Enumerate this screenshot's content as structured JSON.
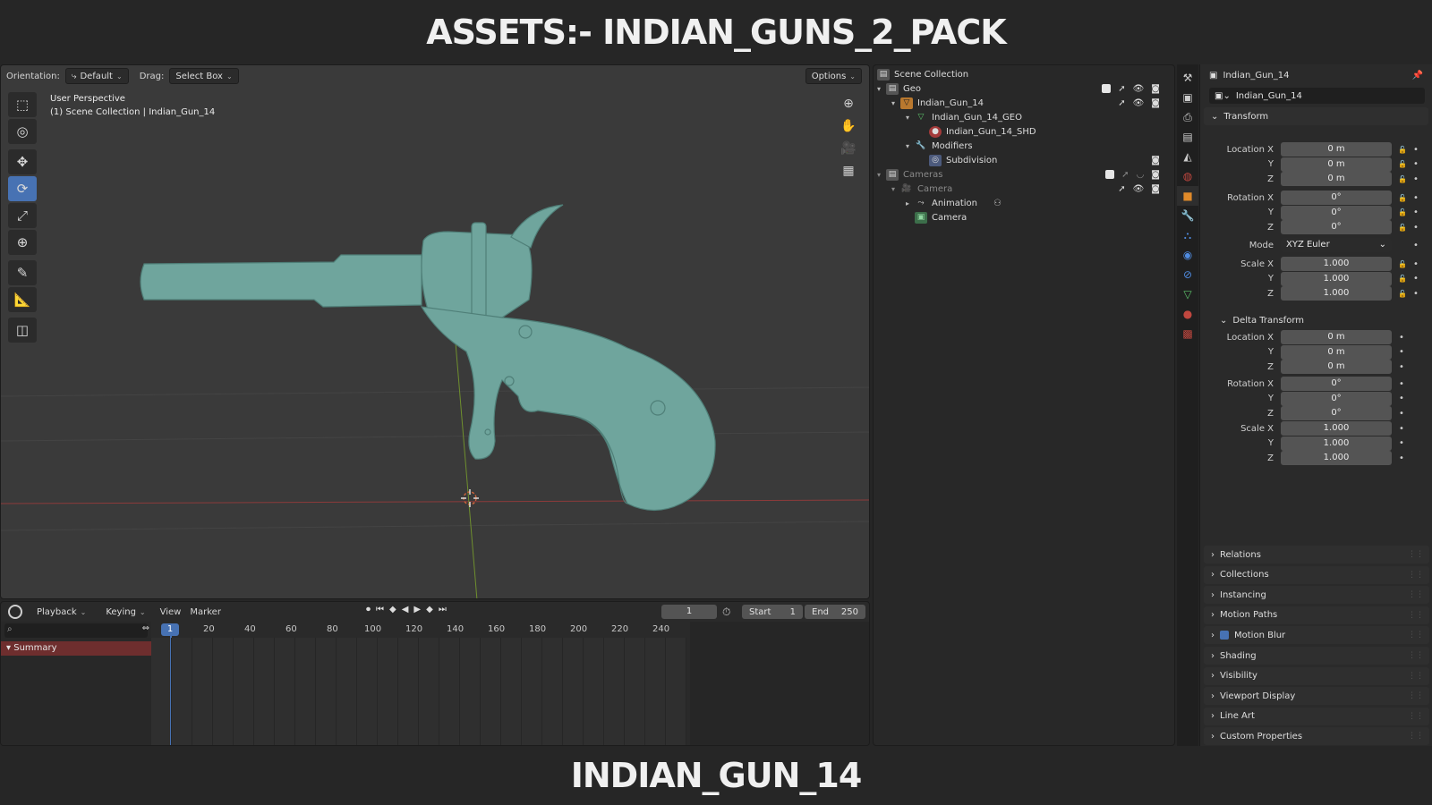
{
  "banner": {
    "top": "ASSETS:- INDIAN_GUNS_2_PACK",
    "bottom": "INDIAN_GUN_14"
  },
  "viewport": {
    "orientation_label": "Orientation:",
    "orientation_value": "Default",
    "drag_label": "Drag:",
    "drag_value": "Select Box",
    "options_label": "Options",
    "view_name": "User Perspective",
    "context": "(1) Scene Collection | Indian_Gun_14",
    "model_color": "#6fa59d"
  },
  "timeline": {
    "menus": [
      "Playback",
      "Keying",
      "View",
      "Marker"
    ],
    "current_frame": "1",
    "start_label": "Start",
    "start_value": "1",
    "end_label": "End",
    "end_value": "250",
    "ruler_marker": "1",
    "ruler": [
      "20",
      "40",
      "60",
      "80",
      "100",
      "120",
      "140",
      "160",
      "180",
      "200",
      "220",
      "240"
    ],
    "summary": "Summary"
  },
  "outliner": {
    "rows": [
      {
        "label": "Scene Collection",
        "icon": "scene-collection-icon"
      },
      {
        "label": "Geo",
        "icon": "collection-icon"
      },
      {
        "label": "Indian_Gun_14",
        "icon": "mesh-object-icon"
      },
      {
        "label": "Indian_Gun_14_GEO",
        "icon": "mesh-data-icon"
      },
      {
        "label": "Indian_Gun_14_SHD",
        "icon": "material-icon"
      },
      {
        "label": "Modifiers",
        "icon": "wrench-icon"
      },
      {
        "label": "Subdivision",
        "icon": "subdivision-icon"
      },
      {
        "label": "Cameras",
        "icon": "collection-icon"
      },
      {
        "label": "Camera",
        "icon": "camera-object-icon"
      },
      {
        "label": "Animation",
        "icon": "animation-icon"
      },
      {
        "label": "Camera",
        "icon": "camera-data-icon"
      }
    ]
  },
  "properties": {
    "object_name": "Indian_Gun_14",
    "name_field": "Indian_Gun_14",
    "transform_header": "Transform",
    "transform": {
      "location_label": "Location X",
      "location": [
        "0 m",
        "0 m",
        "0 m"
      ],
      "rotation_label": "Rotation X",
      "rotation": [
        "0°",
        "0°",
        "0°"
      ],
      "mode_label": "Mode",
      "mode_value": "XYZ Euler",
      "scale_label": "Scale X",
      "scale": [
        "1.000",
        "1.000",
        "1.000"
      ],
      "y_label": "Y",
      "z_label": "Z"
    },
    "delta_header": "Delta Transform",
    "delta": {
      "location": [
        "0 m",
        "0 m",
        "0 m"
      ],
      "rotation": [
        "0°",
        "0°",
        "0°"
      ],
      "scale": [
        "1.000",
        "1.000",
        "1.000"
      ]
    },
    "panels": [
      "Relations",
      "Collections",
      "Instancing",
      "Motion Paths",
      "Motion Blur",
      "Shading",
      "Visibility",
      "Viewport Display",
      "Line Art",
      "Custom Properties"
    ]
  }
}
